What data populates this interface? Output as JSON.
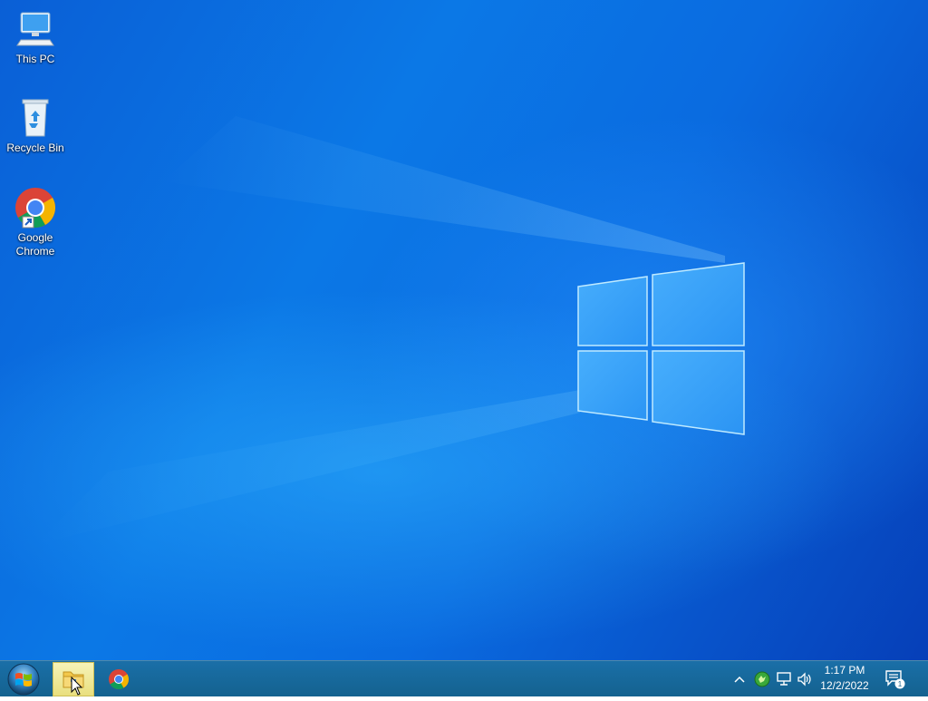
{
  "desktop": {
    "icons": [
      {
        "label": "This PC",
        "icon": "computer-icon"
      },
      {
        "label": "Recycle Bin",
        "icon": "recycle-bin-icon"
      },
      {
        "label_line1": "Google",
        "label_line2": "Chrome",
        "icon": "chrome-icon"
      }
    ]
  },
  "taskbar": {
    "start_icon": "windows-orb-icon",
    "apps": [
      {
        "name": "File Explorer",
        "icon": "folder-icon",
        "active": true
      },
      {
        "name": "Google Chrome",
        "icon": "chrome-icon",
        "active": false
      }
    ],
    "tray": {
      "show_hidden_icon": "chevron-up-icon",
      "icons": [
        "green-app-icon",
        "network-icon",
        "volume-icon"
      ]
    },
    "clock": {
      "time": "1:17 PM",
      "date": "12/2/2022"
    },
    "notifications": {
      "icon": "action-center-icon",
      "count": "1"
    }
  },
  "colors": {
    "wallpaper_blue": "#0a6be0",
    "taskbar": "#1a6fa8",
    "active_app": "#f6f3b8"
  }
}
